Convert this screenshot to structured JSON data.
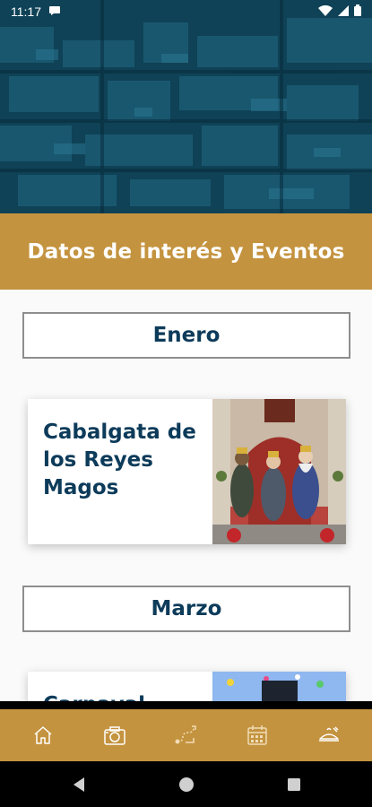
{
  "status_bar": {
    "time": "11:17",
    "icons": [
      "notification-icon",
      "wifi-icon",
      "signal-icon",
      "battery-icon"
    ]
  },
  "header": {
    "title": "Datos de interés y Eventos",
    "background_color": "#c4933f"
  },
  "sections": [
    {
      "month": "Enero",
      "events": [
        {
          "title": "Cabalgata de los Reyes Magos"
        }
      ]
    },
    {
      "month": "Marzo",
      "events": [
        {
          "title": "Carnaval"
        }
      ]
    }
  ],
  "bottom_nav": {
    "items": [
      {
        "icon": "home-icon"
      },
      {
        "icon": "camera-icon"
      },
      {
        "icon": "route-icon"
      },
      {
        "icon": "calendar-icon"
      },
      {
        "icon": "food-icon"
      }
    ]
  },
  "system_nav": {
    "items": [
      "back-icon",
      "home-circle-icon",
      "recents-icon"
    ]
  },
  "colors": {
    "accent": "#c4933f",
    "text_primary": "#0d3b5a",
    "hero_overlay": "#0e3f52"
  }
}
